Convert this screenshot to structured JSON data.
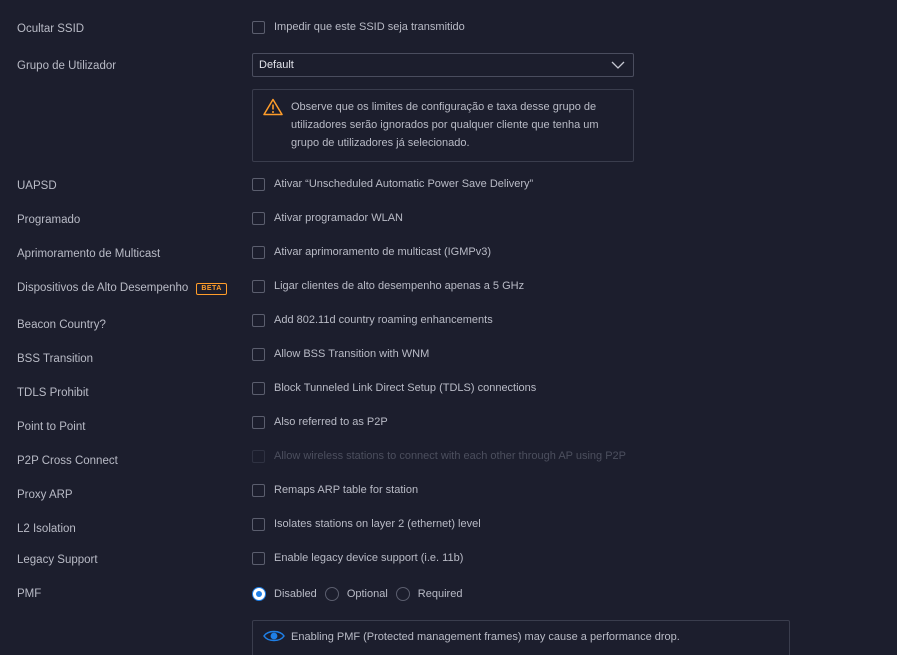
{
  "rows": {
    "hide_ssid": {
      "label": "Ocultar SSID",
      "option": "Impedir que este SSID seja transmitido"
    },
    "user_group": {
      "label": "Grupo de Utilizador",
      "value": "Default"
    },
    "user_group_warning": "Observe que os limites de configuração e taxa desse grupo de utilizadores serão ignorados por qualquer cliente que tenha um grupo de utilizadores já selecionado.",
    "uapsd": {
      "label": "UAPSD",
      "option": "Ativar “Unscheduled Automatic Power Save Delivery”"
    },
    "scheduled": {
      "label": "Programado",
      "option": "Ativar programador WLAN"
    },
    "multicast": {
      "label": "Aprimoramento de Multicast",
      "option": "Ativar aprimoramento de multicast (IGMPv3)"
    },
    "high_perf": {
      "label": "Dispositivos de Alto Desempenho",
      "badge": "BETA",
      "option": "Ligar clientes de alto desempenho apenas a 5 GHz"
    },
    "beacon_country": {
      "label": "Beacon Country?",
      "option": "Add 802.11d country roaming enhancements"
    },
    "bss_transition": {
      "label": "BSS Transition",
      "option": "Allow BSS Transition with WNM"
    },
    "tdls": {
      "label": "TDLS Prohibit",
      "option": "Block Tunneled Link Direct Setup (TDLS) connections"
    },
    "p2p": {
      "label": "Point to Point",
      "option": "Also referred to as P2P"
    },
    "p2p_cross": {
      "label": "P2P Cross Connect",
      "option": "Allow wireless stations to connect with each other through AP using P2P"
    },
    "proxy_arp": {
      "label": "Proxy ARP",
      "option": "Remaps ARP table for station"
    },
    "l2_isolation": {
      "label": "L2 Isolation",
      "option": "Isolates stations on layer 2 (ethernet) level"
    },
    "legacy": {
      "label": "Legacy Support",
      "option": "Enable legacy device support (i.e. 11b)"
    },
    "pmf": {
      "label": "PMF",
      "options": [
        "Disabled",
        "Optional",
        "Required"
      ],
      "selected": "Disabled",
      "info": "Enabling PMF (Protected management frames) may cause a performance drop."
    }
  },
  "icons": {
    "warning": "warning-triangle-icon",
    "info": "eye-icon",
    "chevron": "chevron-down-icon"
  },
  "colors": {
    "background": "#1c1e2d",
    "accent": "#1f7fe6",
    "warning": "#ff9d2a"
  }
}
